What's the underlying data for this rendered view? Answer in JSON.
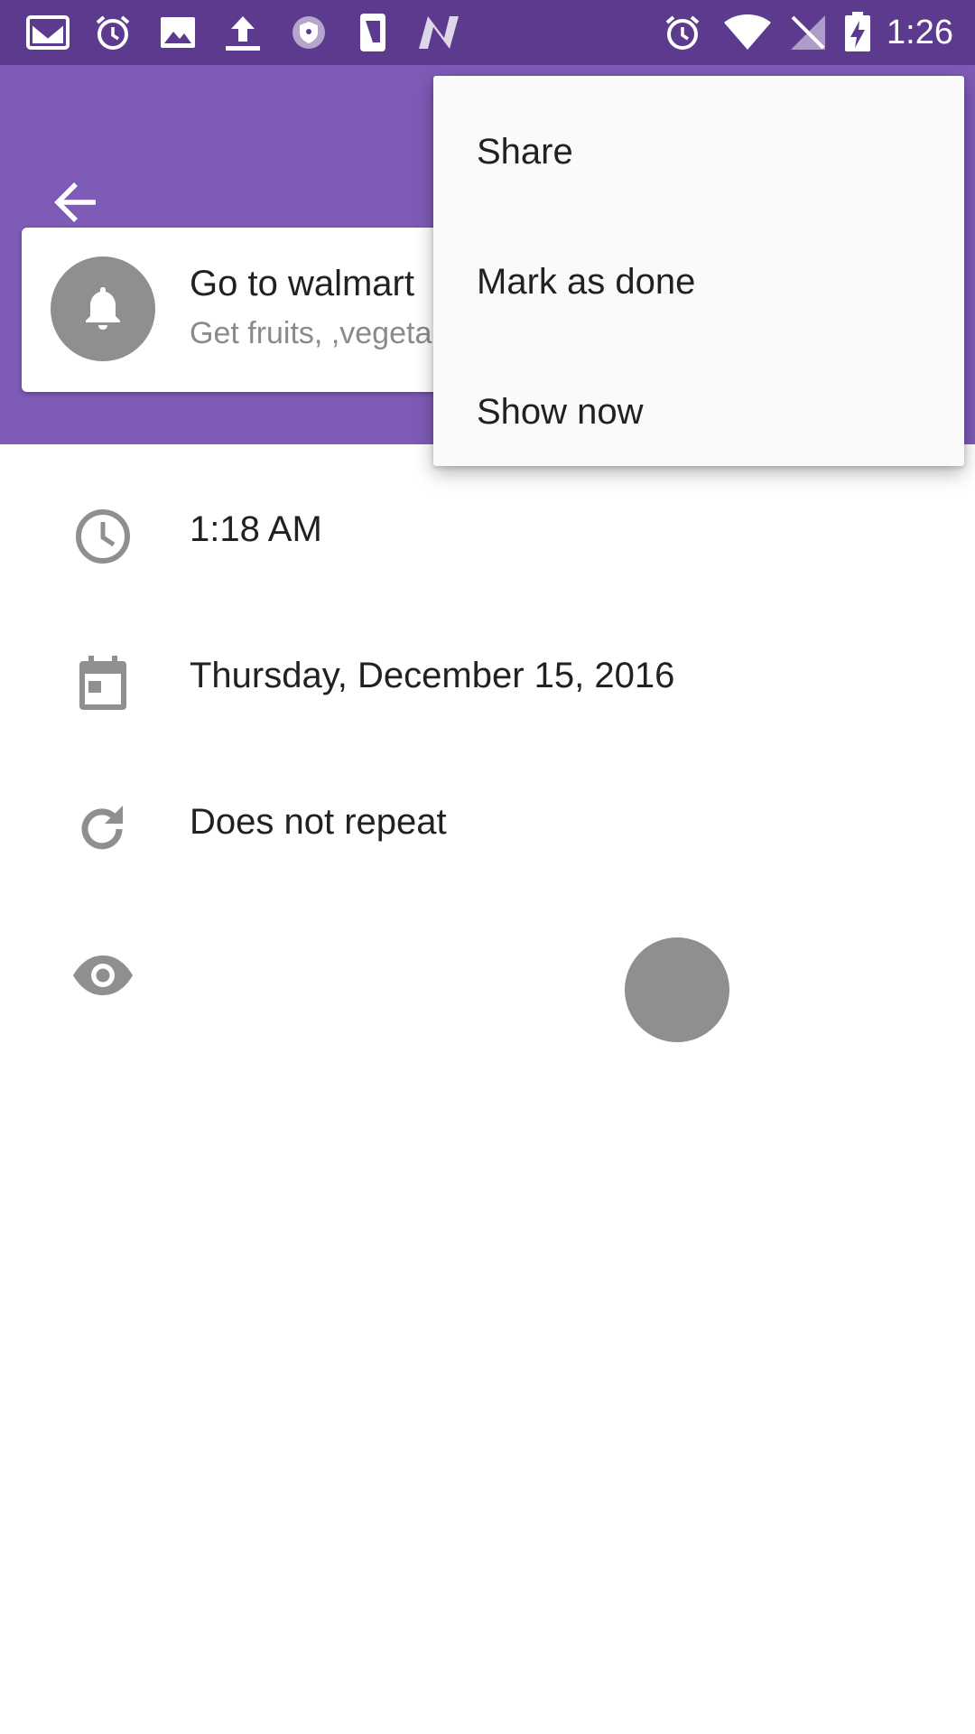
{
  "status_bar": {
    "time": "1:26",
    "left_icons": [
      "gmail-icon",
      "alarm-icon",
      "image-icon",
      "upload-icon",
      "shield-icon",
      "phone-icon",
      "n-logo-icon"
    ],
    "right_icons": [
      "alarm-icon",
      "wifi-icon",
      "no-signal-icon",
      "battery-charging-icon"
    ]
  },
  "colors": {
    "status_bar": "#5c3a8e",
    "app_bar": "#7e5bb6",
    "icon_gray": "#8f8f8f"
  },
  "app_bar": {
    "back_icon": "arrow-left-icon"
  },
  "reminder": {
    "title": "Go to walmart",
    "subtitle": "Get fruits, ,vegeta",
    "icon": "bell-icon"
  },
  "details": [
    {
      "icon": "clock-icon",
      "text": "1:18 AM"
    },
    {
      "icon": "calendar-icon",
      "text": "Thursday, December 15, 2016"
    },
    {
      "icon": "repeat-icon",
      "text": "Does not repeat"
    },
    {
      "icon": "eye-icon",
      "text": ""
    }
  ],
  "menu": {
    "items": [
      {
        "label": "Share"
      },
      {
        "label": "Mark as done"
      },
      {
        "label": "Show now"
      }
    ]
  }
}
